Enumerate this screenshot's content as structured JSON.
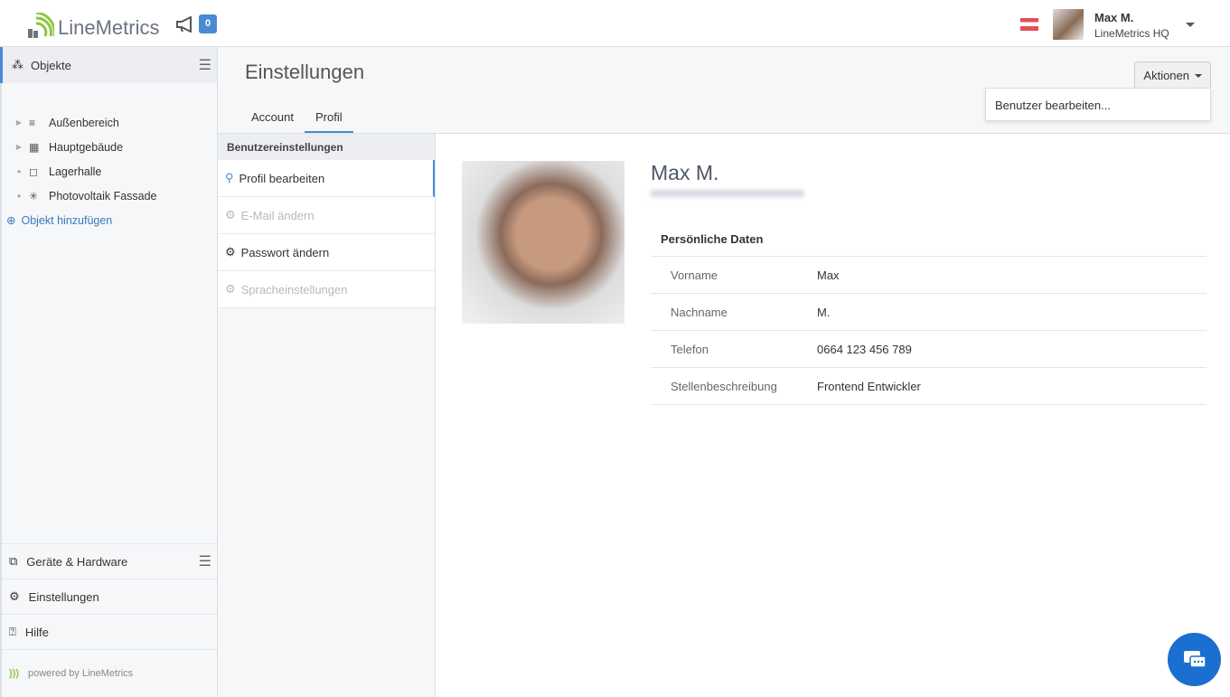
{
  "header": {
    "logo_text": "LineMetrics",
    "notification_count": "0",
    "user_name": "Max M.",
    "user_org": "LineMetrics HQ"
  },
  "sidebar": {
    "section_title": "Objekte",
    "items": [
      {
        "label": "Außenbereich",
        "icon": "area-icon"
      },
      {
        "label": "Hauptgebäude",
        "icon": "building-icon"
      },
      {
        "label": "Lagerhalle",
        "icon": "frame-icon"
      },
      {
        "label": "Photovoltaik Fassade",
        "icon": "spinner-icon"
      }
    ],
    "add_label": "Objekt hinzufügen",
    "bottom": [
      {
        "label": "Geräte & Hardware"
      },
      {
        "label": "Einstellungen"
      },
      {
        "label": "Hilfe"
      }
    ],
    "powered": "powered by LineMetrics"
  },
  "main": {
    "title": "Einstellungen",
    "tabs": [
      {
        "label": "Account"
      },
      {
        "label": "Profil"
      }
    ],
    "actions_label": "Aktionen",
    "dropdown_item": "Benutzer bearbeiten..."
  },
  "subnav": {
    "heading": "Benutzereinstellungen",
    "items": [
      {
        "label": "Profil bearbeiten"
      },
      {
        "label": "E-Mail ändern"
      },
      {
        "label": "Passwort ändern"
      },
      {
        "label": "Spracheinstellungen"
      }
    ]
  },
  "profile": {
    "name": "Max M.",
    "section": "Persönliche Daten",
    "rows": [
      {
        "k": "Vorname",
        "v": "Max"
      },
      {
        "k": "Nachname",
        "v": "M."
      },
      {
        "k": "Telefon",
        "v": "0664 123 456 789"
      },
      {
        "k": "Stellenbeschreibung",
        "v": "Frontend Entwickler"
      }
    ]
  },
  "colors": {
    "accent": "#4a8ad4",
    "chat": "#1a6fd0"
  }
}
